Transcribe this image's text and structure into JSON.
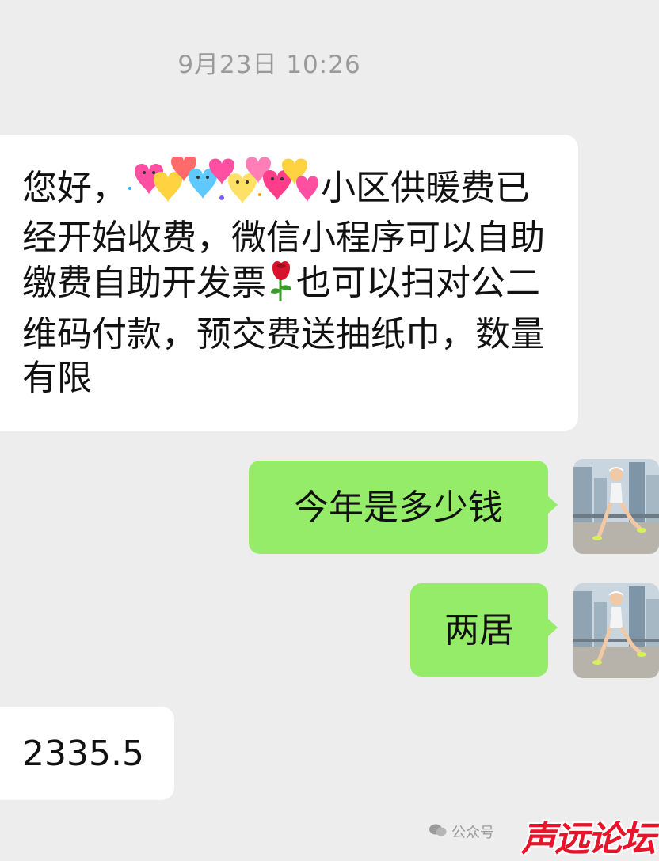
{
  "chat": {
    "timestamp": "9月23日 10:26",
    "messages": [
      {
        "side": "received",
        "text_before_sticker": "您好，",
        "text_after_sticker": "小区供暖费已经开始收费，微信小程序可以自助缴费自助开发票",
        "text_after_emoji": "也可以扫对公二维码付款，预交费送抽纸巾，数量有限",
        "inline_sticker": "heart-stickers-redaction",
        "inline_emoji": "rose-icon"
      },
      {
        "side": "sent",
        "text": "今年是多少钱"
      },
      {
        "side": "sent",
        "text": "两居"
      },
      {
        "side": "received",
        "text": "2335.5"
      }
    ]
  },
  "watermark": {
    "source_text": "公众号",
    "logo_text": "声远论坛"
  },
  "colors": {
    "background": "#ededed",
    "received_bubble": "#ffffff",
    "sent_bubble": "#95ec69",
    "watermark_logo": "#e8142a"
  }
}
